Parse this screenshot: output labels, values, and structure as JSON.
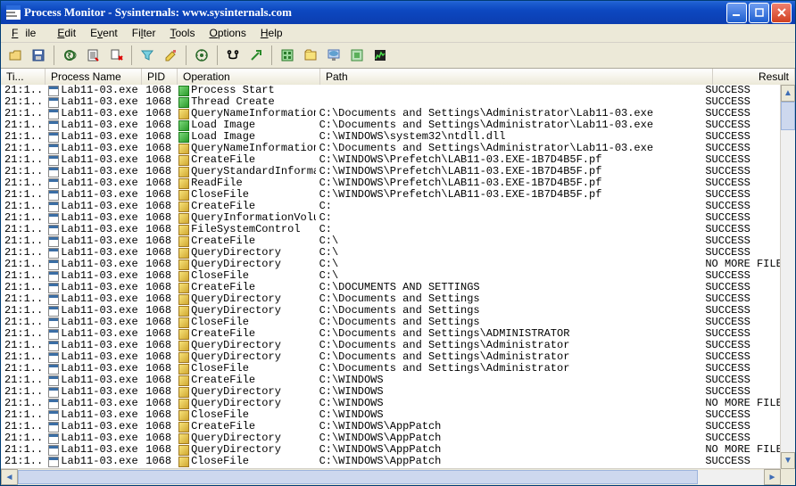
{
  "title": "Process Monitor - Sysinternals: www.sysinternals.com",
  "menu": [
    "File",
    "Edit",
    "Event",
    "Filter",
    "Tools",
    "Options",
    "Help"
  ],
  "columns": {
    "time": "Ti...",
    "process": "Process Name",
    "pid": "PID",
    "operation": "Operation",
    "path": "Path",
    "result": "Result"
  },
  "rows": [
    {
      "t": "21:1...",
      "p": "Lab11-03.exe",
      "pid": "1068",
      "op": "Process Start",
      "oi": "proc",
      "path": "",
      "r": "SUCCESS"
    },
    {
      "t": "21:1...",
      "p": "Lab11-03.exe",
      "pid": "1068",
      "op": "Thread Create",
      "oi": "proc",
      "path": "",
      "r": "SUCCESS"
    },
    {
      "t": "21:1...",
      "p": "Lab11-03.exe",
      "pid": "1068",
      "op": "QueryNameInformationFile",
      "oi": "fs",
      "path": "C:\\Documents and Settings\\Administrator\\Lab11-03.exe",
      "r": "SUCCESS"
    },
    {
      "t": "21:1...",
      "p": "Lab11-03.exe",
      "pid": "1068",
      "op": "Load Image",
      "oi": "proc",
      "path": "C:\\Documents and Settings\\Administrator\\Lab11-03.exe",
      "r": "SUCCESS"
    },
    {
      "t": "21:1...",
      "p": "Lab11-03.exe",
      "pid": "1068",
      "op": "Load Image",
      "oi": "proc",
      "path": "C:\\WINDOWS\\system32\\ntdll.dll",
      "r": "SUCCESS"
    },
    {
      "t": "21:1...",
      "p": "Lab11-03.exe",
      "pid": "1068",
      "op": "QueryNameInformationFile",
      "oi": "fs",
      "path": "C:\\Documents and Settings\\Administrator\\Lab11-03.exe",
      "r": "SUCCESS"
    },
    {
      "t": "21:1...",
      "p": "Lab11-03.exe",
      "pid": "1068",
      "op": "CreateFile",
      "oi": "fs",
      "path": "C:\\WINDOWS\\Prefetch\\LAB11-03.EXE-1B7D4B5F.pf",
      "r": "SUCCESS"
    },
    {
      "t": "21:1...",
      "p": "Lab11-03.exe",
      "pid": "1068",
      "op": "QueryStandardInformat...",
      "oi": "fs",
      "path": "C:\\WINDOWS\\Prefetch\\LAB11-03.EXE-1B7D4B5F.pf",
      "r": "SUCCESS"
    },
    {
      "t": "21:1...",
      "p": "Lab11-03.exe",
      "pid": "1068",
      "op": "ReadFile",
      "oi": "fs",
      "path": "C:\\WINDOWS\\Prefetch\\LAB11-03.EXE-1B7D4B5F.pf",
      "r": "SUCCESS"
    },
    {
      "t": "21:1...",
      "p": "Lab11-03.exe",
      "pid": "1068",
      "op": "CloseFile",
      "oi": "fs",
      "path": "C:\\WINDOWS\\Prefetch\\LAB11-03.EXE-1B7D4B5F.pf",
      "r": "SUCCESS"
    },
    {
      "t": "21:1...",
      "p": "Lab11-03.exe",
      "pid": "1068",
      "op": "CreateFile",
      "oi": "fs",
      "path": "C:",
      "r": "SUCCESS"
    },
    {
      "t": "21:1...",
      "p": "Lab11-03.exe",
      "pid": "1068",
      "op": "QueryInformationVolume",
      "oi": "fs",
      "path": "C:",
      "r": "SUCCESS"
    },
    {
      "t": "21:1...",
      "p": "Lab11-03.exe",
      "pid": "1068",
      "op": "FileSystemControl",
      "oi": "fs",
      "path": "C:",
      "r": "SUCCESS"
    },
    {
      "t": "21:1...",
      "p": "Lab11-03.exe",
      "pid": "1068",
      "op": "CreateFile",
      "oi": "fs",
      "path": "C:\\",
      "r": "SUCCESS"
    },
    {
      "t": "21:1...",
      "p": "Lab11-03.exe",
      "pid": "1068",
      "op": "QueryDirectory",
      "oi": "fs",
      "path": "C:\\",
      "r": "SUCCESS"
    },
    {
      "t": "21:1...",
      "p": "Lab11-03.exe",
      "pid": "1068",
      "op": "QueryDirectory",
      "oi": "fs",
      "path": "C:\\",
      "r": "NO MORE FILES"
    },
    {
      "t": "21:1...",
      "p": "Lab11-03.exe",
      "pid": "1068",
      "op": "CloseFile",
      "oi": "fs",
      "path": "C:\\",
      "r": "SUCCESS"
    },
    {
      "t": "21:1...",
      "p": "Lab11-03.exe",
      "pid": "1068",
      "op": "CreateFile",
      "oi": "fs",
      "path": "C:\\DOCUMENTS AND SETTINGS",
      "r": "SUCCESS"
    },
    {
      "t": "21:1...",
      "p": "Lab11-03.exe",
      "pid": "1068",
      "op": "QueryDirectory",
      "oi": "fs",
      "path": "C:\\Documents and Settings",
      "r": "SUCCESS"
    },
    {
      "t": "21:1...",
      "p": "Lab11-03.exe",
      "pid": "1068",
      "op": "QueryDirectory",
      "oi": "fs",
      "path": "C:\\Documents and Settings",
      "r": "SUCCESS"
    },
    {
      "t": "21:1...",
      "p": "Lab11-03.exe",
      "pid": "1068",
      "op": "CloseFile",
      "oi": "fs",
      "path": "C:\\Documents and Settings",
      "r": "SUCCESS"
    },
    {
      "t": "21:1...",
      "p": "Lab11-03.exe",
      "pid": "1068",
      "op": "CreateFile",
      "oi": "fs",
      "path": "C:\\Documents and Settings\\ADMINISTRATOR",
      "r": "SUCCESS"
    },
    {
      "t": "21:1...",
      "p": "Lab11-03.exe",
      "pid": "1068",
      "op": "QueryDirectory",
      "oi": "fs",
      "path": "C:\\Documents and Settings\\Administrator",
      "r": "SUCCESS"
    },
    {
      "t": "21:1...",
      "p": "Lab11-03.exe",
      "pid": "1068",
      "op": "QueryDirectory",
      "oi": "fs",
      "path": "C:\\Documents and Settings\\Administrator",
      "r": "SUCCESS"
    },
    {
      "t": "21:1...",
      "p": "Lab11-03.exe",
      "pid": "1068",
      "op": "CloseFile",
      "oi": "fs",
      "path": "C:\\Documents and Settings\\Administrator",
      "r": "SUCCESS"
    },
    {
      "t": "21:1...",
      "p": "Lab11-03.exe",
      "pid": "1068",
      "op": "CreateFile",
      "oi": "fs",
      "path": "C:\\WINDOWS",
      "r": "SUCCESS"
    },
    {
      "t": "21:1...",
      "p": "Lab11-03.exe",
      "pid": "1068",
      "op": "QueryDirectory",
      "oi": "fs",
      "path": "C:\\WINDOWS",
      "r": "SUCCESS"
    },
    {
      "t": "21:1...",
      "p": "Lab11-03.exe",
      "pid": "1068",
      "op": "QueryDirectory",
      "oi": "fs",
      "path": "C:\\WINDOWS",
      "r": "NO MORE FILES"
    },
    {
      "t": "21:1...",
      "p": "Lab11-03.exe",
      "pid": "1068",
      "op": "CloseFile",
      "oi": "fs",
      "path": "C:\\WINDOWS",
      "r": "SUCCESS"
    },
    {
      "t": "21:1...",
      "p": "Lab11-03.exe",
      "pid": "1068",
      "op": "CreateFile",
      "oi": "fs",
      "path": "C:\\WINDOWS\\AppPatch",
      "r": "SUCCESS"
    },
    {
      "t": "21:1...",
      "p": "Lab11-03.exe",
      "pid": "1068",
      "op": "QueryDirectory",
      "oi": "fs",
      "path": "C:\\WINDOWS\\AppPatch",
      "r": "SUCCESS"
    },
    {
      "t": "21:1...",
      "p": "Lab11-03.exe",
      "pid": "1068",
      "op": "QueryDirectory",
      "oi": "fs",
      "path": "C:\\WINDOWS\\AppPatch",
      "r": "NO MORE FILES"
    },
    {
      "t": "21:1...",
      "p": "Lab11-03.exe",
      "pid": "1068",
      "op": "CloseFile",
      "oi": "fs",
      "path": "C:\\WINDOWS\\AppPatch",
      "r": "SUCCESS"
    }
  ],
  "toolbar_icons": [
    "open",
    "save",
    "sep",
    "capture",
    "autoscroll",
    "clear",
    "sep",
    "filter",
    "highlight",
    "sep",
    "include-process",
    "sep",
    "find",
    "jump",
    "sep",
    "registry-activity",
    "file-activity",
    "network-activity",
    "process-activity",
    "profiling"
  ]
}
